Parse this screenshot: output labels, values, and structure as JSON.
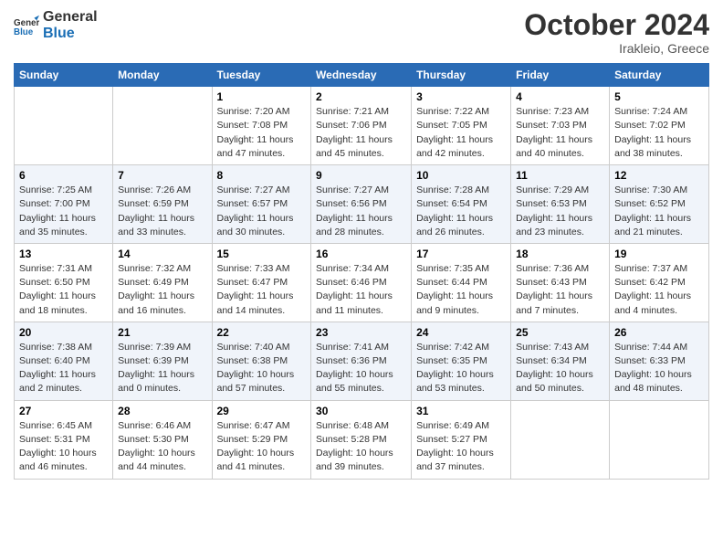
{
  "logo": {
    "line1": "General",
    "line2": "Blue"
  },
  "title": "October 2024",
  "subtitle": "Irakleio, Greece",
  "headers": [
    "Sunday",
    "Monday",
    "Tuesday",
    "Wednesday",
    "Thursday",
    "Friday",
    "Saturday"
  ],
  "weeks": [
    [
      {
        "day": "",
        "info": ""
      },
      {
        "day": "",
        "info": ""
      },
      {
        "day": "1",
        "info": "Sunrise: 7:20 AM\nSunset: 7:08 PM\nDaylight: 11 hours and 47 minutes."
      },
      {
        "day": "2",
        "info": "Sunrise: 7:21 AM\nSunset: 7:06 PM\nDaylight: 11 hours and 45 minutes."
      },
      {
        "day": "3",
        "info": "Sunrise: 7:22 AM\nSunset: 7:05 PM\nDaylight: 11 hours and 42 minutes."
      },
      {
        "day": "4",
        "info": "Sunrise: 7:23 AM\nSunset: 7:03 PM\nDaylight: 11 hours and 40 minutes."
      },
      {
        "day": "5",
        "info": "Sunrise: 7:24 AM\nSunset: 7:02 PM\nDaylight: 11 hours and 38 minutes."
      }
    ],
    [
      {
        "day": "6",
        "info": "Sunrise: 7:25 AM\nSunset: 7:00 PM\nDaylight: 11 hours and 35 minutes."
      },
      {
        "day": "7",
        "info": "Sunrise: 7:26 AM\nSunset: 6:59 PM\nDaylight: 11 hours and 33 minutes."
      },
      {
        "day": "8",
        "info": "Sunrise: 7:27 AM\nSunset: 6:57 PM\nDaylight: 11 hours and 30 minutes."
      },
      {
        "day": "9",
        "info": "Sunrise: 7:27 AM\nSunset: 6:56 PM\nDaylight: 11 hours and 28 minutes."
      },
      {
        "day": "10",
        "info": "Sunrise: 7:28 AM\nSunset: 6:54 PM\nDaylight: 11 hours and 26 minutes."
      },
      {
        "day": "11",
        "info": "Sunrise: 7:29 AM\nSunset: 6:53 PM\nDaylight: 11 hours and 23 minutes."
      },
      {
        "day": "12",
        "info": "Sunrise: 7:30 AM\nSunset: 6:52 PM\nDaylight: 11 hours and 21 minutes."
      }
    ],
    [
      {
        "day": "13",
        "info": "Sunrise: 7:31 AM\nSunset: 6:50 PM\nDaylight: 11 hours and 18 minutes."
      },
      {
        "day": "14",
        "info": "Sunrise: 7:32 AM\nSunset: 6:49 PM\nDaylight: 11 hours and 16 minutes."
      },
      {
        "day": "15",
        "info": "Sunrise: 7:33 AM\nSunset: 6:47 PM\nDaylight: 11 hours and 14 minutes."
      },
      {
        "day": "16",
        "info": "Sunrise: 7:34 AM\nSunset: 6:46 PM\nDaylight: 11 hours and 11 minutes."
      },
      {
        "day": "17",
        "info": "Sunrise: 7:35 AM\nSunset: 6:44 PM\nDaylight: 11 hours and 9 minutes."
      },
      {
        "day": "18",
        "info": "Sunrise: 7:36 AM\nSunset: 6:43 PM\nDaylight: 11 hours and 7 minutes."
      },
      {
        "day": "19",
        "info": "Sunrise: 7:37 AM\nSunset: 6:42 PM\nDaylight: 11 hours and 4 minutes."
      }
    ],
    [
      {
        "day": "20",
        "info": "Sunrise: 7:38 AM\nSunset: 6:40 PM\nDaylight: 11 hours and 2 minutes."
      },
      {
        "day": "21",
        "info": "Sunrise: 7:39 AM\nSunset: 6:39 PM\nDaylight: 11 hours and 0 minutes."
      },
      {
        "day": "22",
        "info": "Sunrise: 7:40 AM\nSunset: 6:38 PM\nDaylight: 10 hours and 57 minutes."
      },
      {
        "day": "23",
        "info": "Sunrise: 7:41 AM\nSunset: 6:36 PM\nDaylight: 10 hours and 55 minutes."
      },
      {
        "day": "24",
        "info": "Sunrise: 7:42 AM\nSunset: 6:35 PM\nDaylight: 10 hours and 53 minutes."
      },
      {
        "day": "25",
        "info": "Sunrise: 7:43 AM\nSunset: 6:34 PM\nDaylight: 10 hours and 50 minutes."
      },
      {
        "day": "26",
        "info": "Sunrise: 7:44 AM\nSunset: 6:33 PM\nDaylight: 10 hours and 48 minutes."
      }
    ],
    [
      {
        "day": "27",
        "info": "Sunrise: 6:45 AM\nSunset: 5:31 PM\nDaylight: 10 hours and 46 minutes."
      },
      {
        "day": "28",
        "info": "Sunrise: 6:46 AM\nSunset: 5:30 PM\nDaylight: 10 hours and 44 minutes."
      },
      {
        "day": "29",
        "info": "Sunrise: 6:47 AM\nSunset: 5:29 PM\nDaylight: 10 hours and 41 minutes."
      },
      {
        "day": "30",
        "info": "Sunrise: 6:48 AM\nSunset: 5:28 PM\nDaylight: 10 hours and 39 minutes."
      },
      {
        "day": "31",
        "info": "Sunrise: 6:49 AM\nSunset: 5:27 PM\nDaylight: 10 hours and 37 minutes."
      },
      {
        "day": "",
        "info": ""
      },
      {
        "day": "",
        "info": ""
      }
    ]
  ]
}
